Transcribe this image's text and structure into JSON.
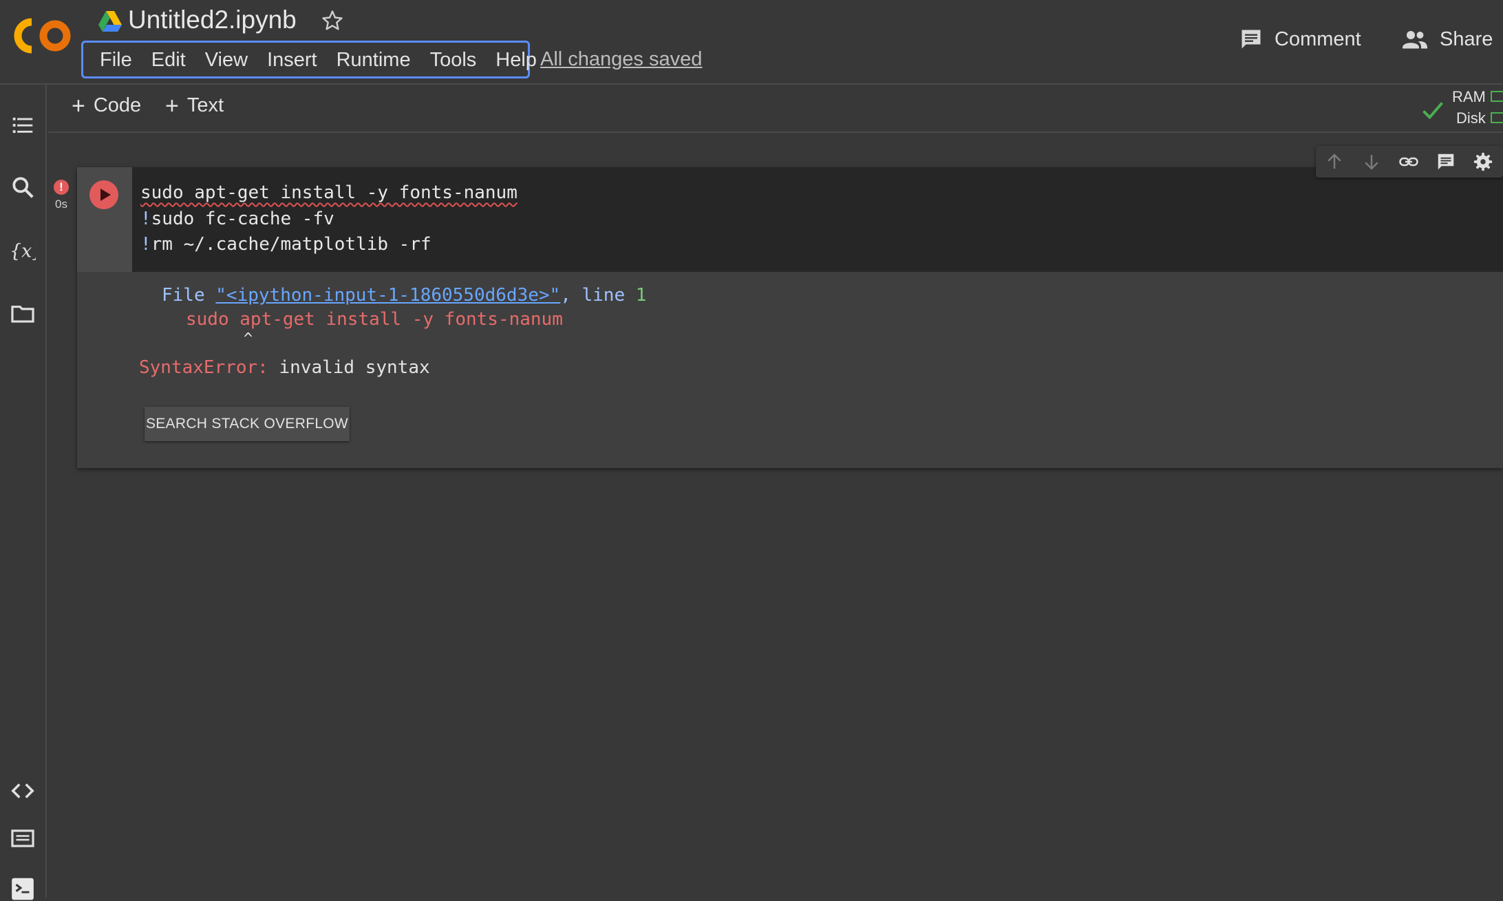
{
  "header": {
    "doc_title": "Untitled2.ipynb",
    "menu": [
      "File",
      "Edit",
      "View",
      "Insert",
      "Runtime",
      "Tools",
      "Help"
    ],
    "saved_status": "All changes saved",
    "comment_label": "Comment",
    "share_label": "Share"
  },
  "toolbar": {
    "add_code_label": "Code",
    "add_text_label": "Text",
    "ram_label": "RAM",
    "disk_label": "Disk"
  },
  "cell": {
    "exec_time": "0s",
    "error_marker": "!",
    "code_lines": [
      "sudo apt-get install -y fonts-nanum",
      "!sudo fc-cache -fv",
      "!rm ~/.cache/matplotlib -rf"
    ],
    "code_bang": "!",
    "code_line2_rest": "sudo fc-cache -fv",
    "code_line3_rest": "rm ~/.cache/matplotlib -rf",
    "output": {
      "file_prefix": "File ",
      "file_path": "\"<ipython-input-1-1860550d6d3e>\"",
      "line_text": ", line ",
      "line_no": "1",
      "error_code_line": "sudo apt-get install -y fonts-nanum",
      "caret": "^",
      "error_name": "SyntaxError:",
      "error_message": " invalid syntax"
    },
    "search_button_label": "SEARCH STACK OVERFLOW"
  },
  "colors": {
    "background": "#383838",
    "code_bg": "#262626",
    "accent_blue": "#5b8cff",
    "error_red": "#e25b5b",
    "ok_green": "#4caf50"
  },
  "icons": [
    "colab-logo",
    "drive-icon",
    "star-icon",
    "comment-icon",
    "share-icon",
    "toc-icon",
    "search-icon",
    "variables-icon",
    "folder-icon",
    "code-snippets-icon",
    "command-palette-icon",
    "terminal-icon",
    "check-icon",
    "arrow-up-icon",
    "arrow-down-icon",
    "link-icon",
    "comment-cell-icon",
    "gear-icon",
    "play-icon"
  ]
}
